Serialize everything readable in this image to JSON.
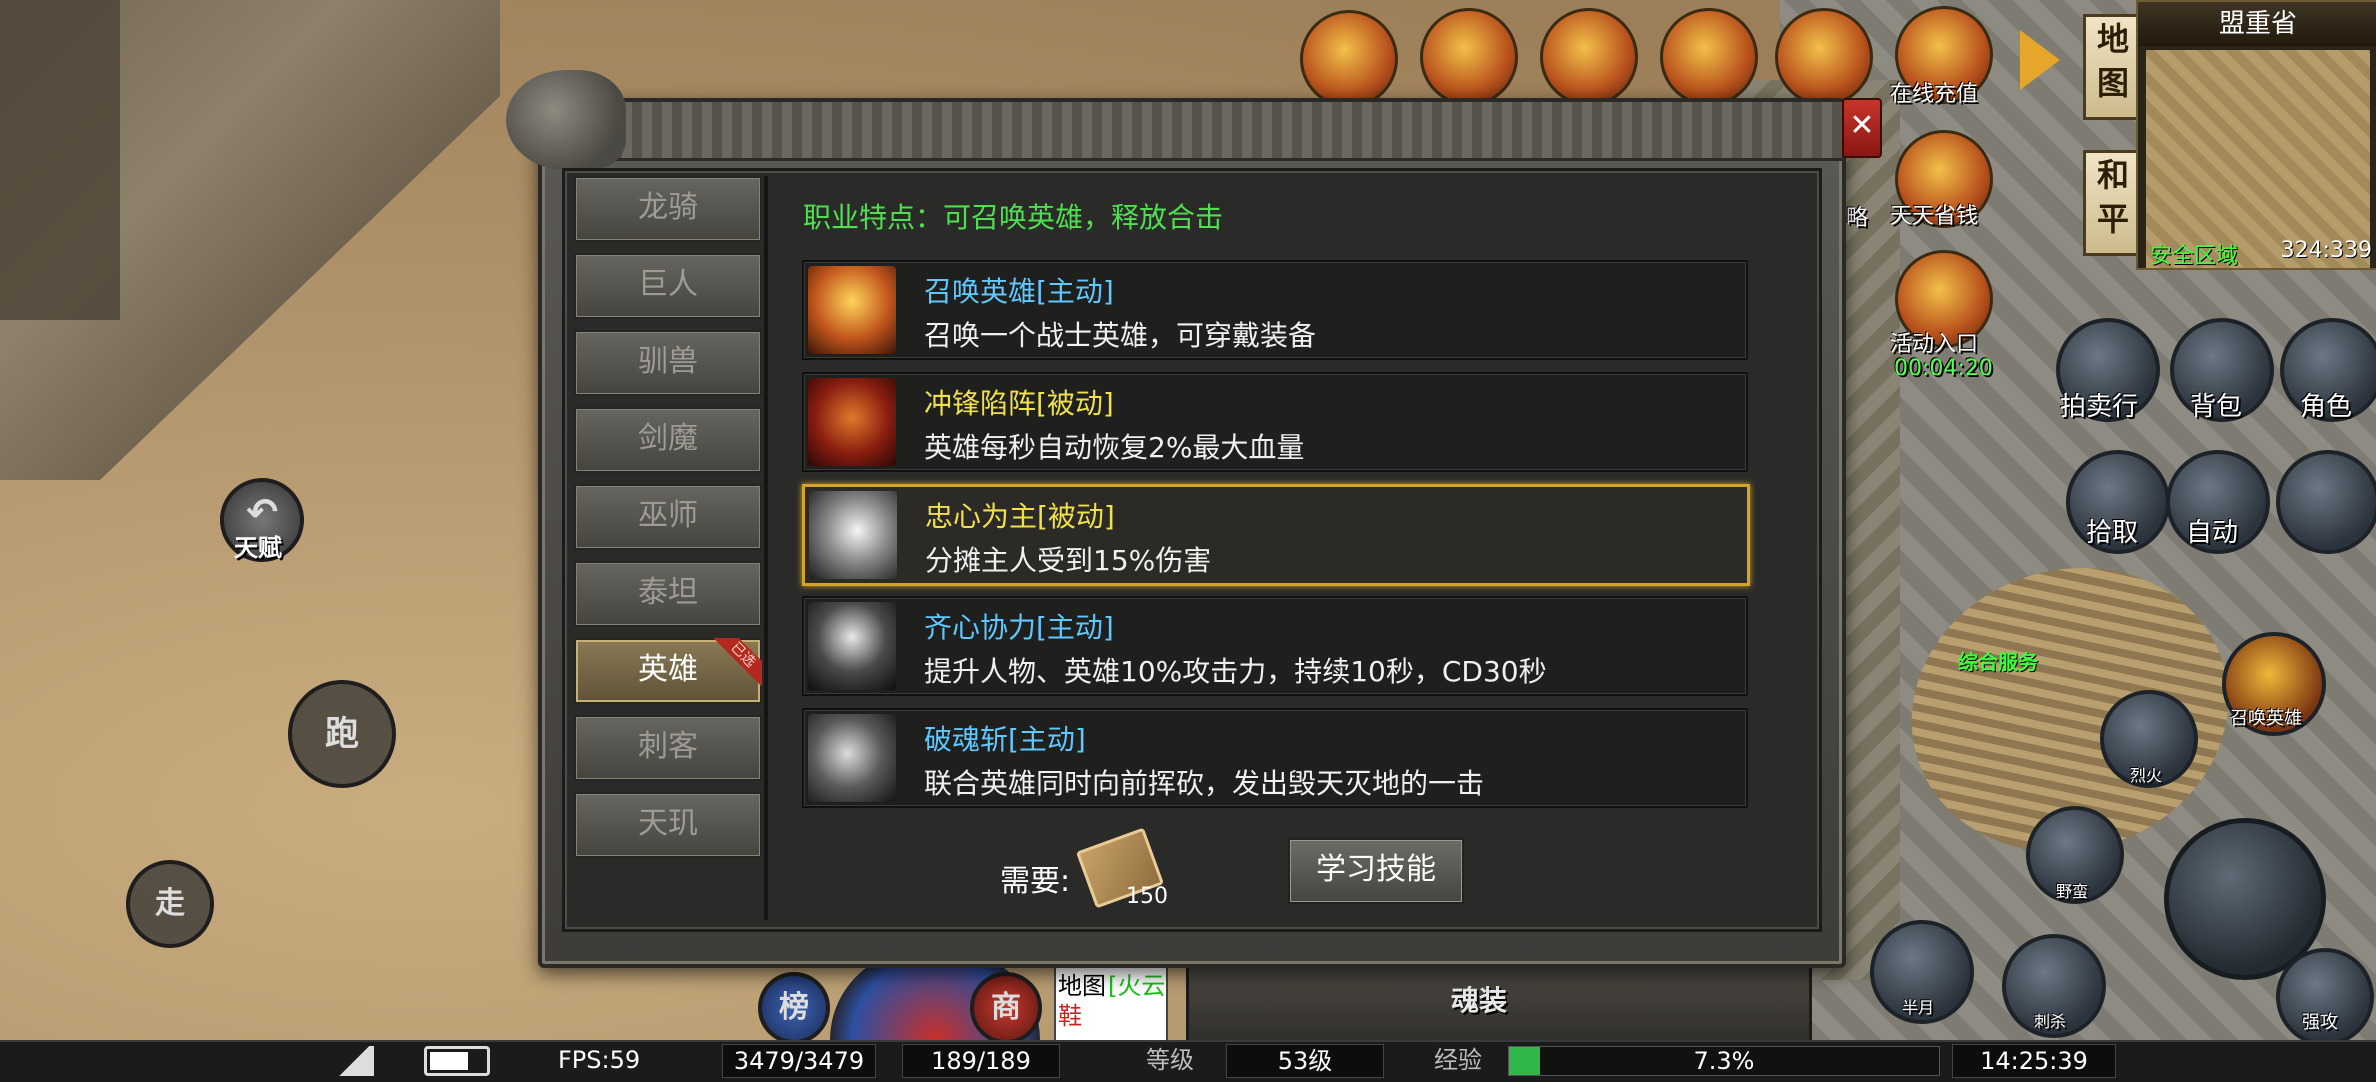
{
  "region": "盟重省",
  "map": {
    "btn1": "地图",
    "btn2": "和平",
    "safe_zone": "安全区域",
    "coords": "324:339"
  },
  "top_icons": [
    {
      "label": "在线充值"
    },
    {
      "label": "天天省钱"
    }
  ],
  "side_labels": {
    "strategy": "略",
    "activity": "活动入口",
    "timer": "00:04:20"
  },
  "right_buttons": [
    "拍卖行",
    "背包",
    "角色",
    "拾取",
    "自动"
  ],
  "npc_labels": {
    "service": "综合服务",
    "summon_hero": "召唤英雄"
  },
  "skill_buttons": [
    "烈火",
    "野蛮",
    "半月",
    "刺杀",
    "强攻"
  ],
  "left_controls": {
    "talent": "天赋",
    "run": "跑",
    "walk": "走"
  },
  "dialog": {
    "tabs": [
      "龙骑",
      "巨人",
      "驯兽",
      "剑魔",
      "巫师",
      "泰坦",
      "英雄",
      "刺客",
      "天玑"
    ],
    "active_tab": "英雄",
    "active_badge": "已选",
    "feature": "职业特点：可召唤英雄，释放合击",
    "skills": [
      {
        "name": "召唤英雄[主动]",
        "desc": "召唤一个战士英雄，可穿戴装备",
        "name_color": "#5fc8ff",
        "icon": "summon-hero-icon"
      },
      {
        "name": "冲锋陷阵[被动]",
        "desc": "英雄每秒自动恢复2%最大血量",
        "name_color": "#f0e04a",
        "icon": "charge-icon"
      },
      {
        "name": "忠心为主[被动]",
        "desc": "分摊主人受到15%伤害",
        "name_color": "#f0e04a",
        "icon": "loyalty-icon"
      },
      {
        "name": "齐心协力[主动]",
        "desc": "提升人物、英雄10%攻击力，持续10秒，CD30秒",
        "name_color": "#5fc8ff",
        "icon": "cooperation-icon"
      },
      {
        "name": "破魂斩[主动]",
        "desc": "联合英雄同时向前挥砍，发出毁天灭地的一击",
        "name_color": "#5fc8ff",
        "icon": "soul-slash-icon"
      }
    ],
    "need_label": "需要:",
    "need_count": "150",
    "learn_button": "学习技能"
  },
  "bottom_menu": {
    "rank": "榜",
    "shop": "商"
  },
  "chat_lines": [
    "地图",
    "鞋"
  ],
  "chat_highlight": "[火云",
  "bottom_panel_label": "魂装",
  "status_bar": {
    "fps": "FPS:59",
    "hp": "3479/3479",
    "mp": "189/189",
    "level_label": "等级",
    "level": "53级",
    "exp_label": "经验",
    "exp": "7.3%",
    "exp_fraction": 0.073,
    "time": "14:25:39"
  }
}
